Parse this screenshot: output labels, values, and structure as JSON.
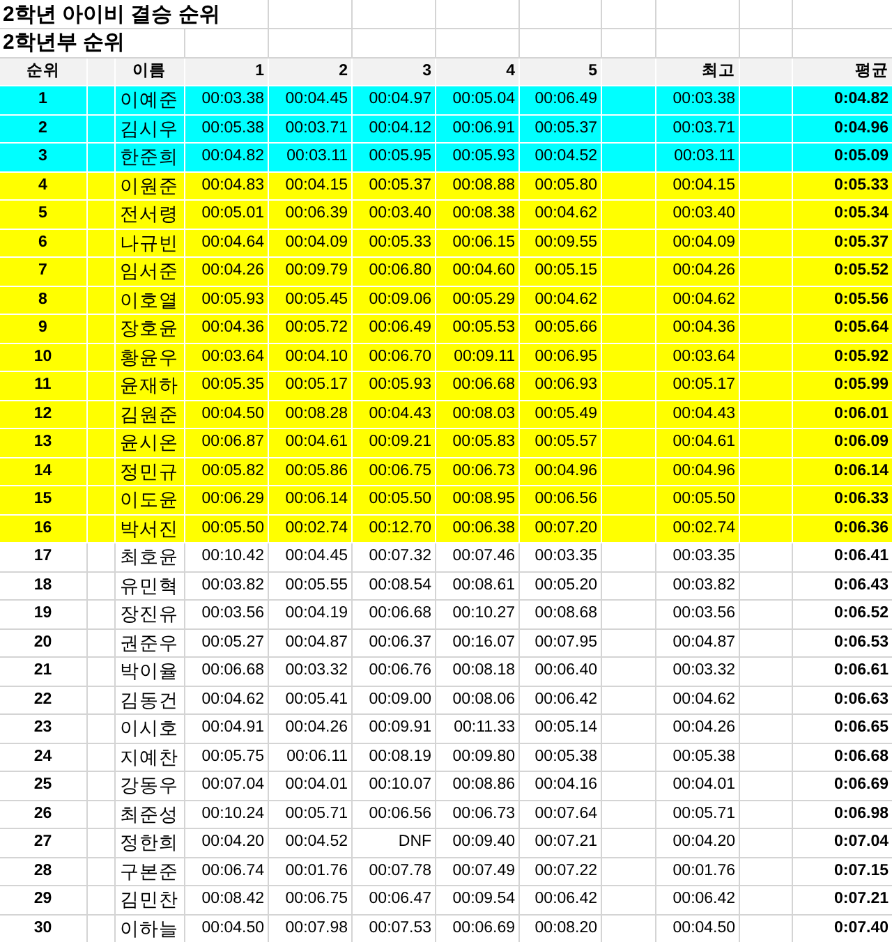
{
  "title": "2학년 아이비 결승 순위",
  "subtitle": "2학년부 순위",
  "columns": [
    "순위",
    "이름",
    "1",
    "2",
    "3",
    "4",
    "5",
    "최고",
    "평균"
  ],
  "rows": [
    {
      "rank": "1",
      "name": "이예준",
      "times": [
        "00:03.38",
        "00:04.45",
        "00:04.97",
        "00:05.04",
        "00:06.49"
      ],
      "best": "00:03.38",
      "average": "0:04.82",
      "color": "#00ffff"
    },
    {
      "rank": "2",
      "name": "김시우",
      "times": [
        "00:05.38",
        "00:03.71",
        "00:04.12",
        "00:06.91",
        "00:05.37"
      ],
      "best": "00:03.71",
      "average": "0:04.96",
      "color": "#00ffff"
    },
    {
      "rank": "3",
      "name": "한준희",
      "times": [
        "00:04.82",
        "00:03.11",
        "00:05.95",
        "00:05.93",
        "00:04.52"
      ],
      "best": "00:03.11",
      "average": "0:05.09",
      "color": "#00ffff"
    },
    {
      "rank": "4",
      "name": "이원준",
      "times": [
        "00:04.83",
        "00:04.15",
        "00:05.37",
        "00:08.88",
        "00:05.80"
      ],
      "best": "00:04.15",
      "average": "0:05.33",
      "color": "#ffff00"
    },
    {
      "rank": "5",
      "name": "전서령",
      "times": [
        "00:05.01",
        "00:06.39",
        "00:03.40",
        "00:08.38",
        "00:04.62"
      ],
      "best": "00:03.40",
      "average": "0:05.34",
      "color": "#ffff00"
    },
    {
      "rank": "6",
      "name": "나규빈",
      "times": [
        "00:04.64",
        "00:04.09",
        "00:05.33",
        "00:06.15",
        "00:09.55"
      ],
      "best": "00:04.09",
      "average": "0:05.37",
      "color": "#ffff00"
    },
    {
      "rank": "7",
      "name": "임서준",
      "times": [
        "00:04.26",
        "00:09.79",
        "00:06.80",
        "00:04.60",
        "00:05.15"
      ],
      "best": "00:04.26",
      "average": "0:05.52",
      "color": "#ffff00"
    },
    {
      "rank": "8",
      "name": "이호열",
      "times": [
        "00:05.93",
        "00:05.45",
        "00:09.06",
        "00:05.29",
        "00:04.62"
      ],
      "best": "00:04.62",
      "average": "0:05.56",
      "color": "#ffff00"
    },
    {
      "rank": "9",
      "name": "장호윤",
      "times": [
        "00:04.36",
        "00:05.72",
        "00:06.49",
        "00:05.53",
        "00:05.66"
      ],
      "best": "00:04.36",
      "average": "0:05.64",
      "color": "#ffff00"
    },
    {
      "rank": "10",
      "name": "황윤우",
      "times": [
        "00:03.64",
        "00:04.10",
        "00:06.70",
        "00:09.11",
        "00:06.95"
      ],
      "best": "00:03.64",
      "average": "0:05.92",
      "color": "#ffff00"
    },
    {
      "rank": "11",
      "name": "윤재하",
      "times": [
        "00:05.35",
        "00:05.17",
        "00:05.93",
        "00:06.68",
        "00:06.93"
      ],
      "best": "00:05.17",
      "average": "0:05.99",
      "color": "#ffff00"
    },
    {
      "rank": "12",
      "name": "김원준",
      "times": [
        "00:04.50",
        "00:08.28",
        "00:04.43",
        "00:08.03",
        "00:05.49"
      ],
      "best": "00:04.43",
      "average": "0:06.01",
      "color": "#ffff00"
    },
    {
      "rank": "13",
      "name": "윤시온",
      "times": [
        "00:06.87",
        "00:04.61",
        "00:09.21",
        "00:05.83",
        "00:05.57"
      ],
      "best": "00:04.61",
      "average": "0:06.09",
      "color": "#ffff00"
    },
    {
      "rank": "14",
      "name": "정민규",
      "times": [
        "00:05.82",
        "00:05.86",
        "00:06.75",
        "00:06.73",
        "00:04.96"
      ],
      "best": "00:04.96",
      "average": "0:06.14",
      "color": "#ffff00"
    },
    {
      "rank": "15",
      "name": "이도윤",
      "times": [
        "00:06.29",
        "00:06.14",
        "00:05.50",
        "00:08.95",
        "00:06.56"
      ],
      "best": "00:05.50",
      "average": "0:06.33",
      "color": "#ffff00"
    },
    {
      "rank": "16",
      "name": "박서진",
      "times": [
        "00:05.50",
        "00:02.74",
        "00:12.70",
        "00:06.38",
        "00:07.20"
      ],
      "best": "00:02.74",
      "average": "0:06.36",
      "color": "#ffff00"
    },
    {
      "rank": "17",
      "name": "최호윤",
      "times": [
        "00:10.42",
        "00:04.45",
        "00:07.32",
        "00:07.46",
        "00:03.35"
      ],
      "best": "00:03.35",
      "average": "0:06.41"
    },
    {
      "rank": "18",
      "name": "유민혁",
      "times": [
        "00:03.82",
        "00:05.55",
        "00:08.54",
        "00:08.61",
        "00:05.20"
      ],
      "best": "00:03.82",
      "average": "0:06.43"
    },
    {
      "rank": "19",
      "name": "장진유",
      "times": [
        "00:03.56",
        "00:04.19",
        "00:06.68",
        "00:10.27",
        "00:08.68"
      ],
      "best": "00:03.56",
      "average": "0:06.52"
    },
    {
      "rank": "20",
      "name": "권준우",
      "times": [
        "00:05.27",
        "00:04.87",
        "00:06.37",
        "00:16.07",
        "00:07.95"
      ],
      "best": "00:04.87",
      "average": "0:06.53"
    },
    {
      "rank": "21",
      "name": "박이율",
      "times": [
        "00:06.68",
        "00:03.32",
        "00:06.76",
        "00:08.18",
        "00:06.40"
      ],
      "best": "00:03.32",
      "average": "0:06.61"
    },
    {
      "rank": "22",
      "name": "김동건",
      "times": [
        "00:04.62",
        "00:05.41",
        "00:09.00",
        "00:08.06",
        "00:06.42"
      ],
      "best": "00:04.62",
      "average": "0:06.63"
    },
    {
      "rank": "23",
      "name": "이시호",
      "times": [
        "00:04.91",
        "00:04.26",
        "00:09.91",
        "00:11.33",
        "00:05.14"
      ],
      "best": "00:04.26",
      "average": "0:06.65"
    },
    {
      "rank": "24",
      "name": "지예찬",
      "times": [
        "00:05.75",
        "00:06.11",
        "00:08.19",
        "00:09.80",
        "00:05.38"
      ],
      "best": "00:05.38",
      "average": "0:06.68"
    },
    {
      "rank": "25",
      "name": "강동우",
      "times": [
        "00:07.04",
        "00:04.01",
        "00:10.07",
        "00:08.86",
        "00:04.16"
      ],
      "best": "00:04.01",
      "average": "0:06.69"
    },
    {
      "rank": "26",
      "name": "최준성",
      "times": [
        "00:10.24",
        "00:05.71",
        "00:06.56",
        "00:06.73",
        "00:07.64"
      ],
      "best": "00:05.71",
      "average": "0:06.98"
    },
    {
      "rank": "27",
      "name": "정한희",
      "times": [
        "00:04.20",
        "00:04.52",
        "DNF",
        "00:09.40",
        "00:07.21"
      ],
      "best": "00:04.20",
      "average": "0:07.04"
    },
    {
      "rank": "28",
      "name": "구본준",
      "times": [
        "00:06.74",
        "00:01.76",
        "00:07.78",
        "00:07.49",
        "00:07.22"
      ],
      "best": "00:01.76",
      "average": "0:07.15"
    },
    {
      "rank": "29",
      "name": "김민찬",
      "times": [
        "00:08.42",
        "00:06.75",
        "00:06.47",
        "00:09.54",
        "00:06.42"
      ],
      "best": "00:06.42",
      "average": "0:07.21"
    },
    {
      "rank": "30",
      "name": "이하늘",
      "times": [
        "00:04.50",
        "00:07.98",
        "00:07.53",
        "00:06.69",
        "00:08.20"
      ],
      "best": "00:04.50",
      "average": "0:07.40"
    }
  ]
}
